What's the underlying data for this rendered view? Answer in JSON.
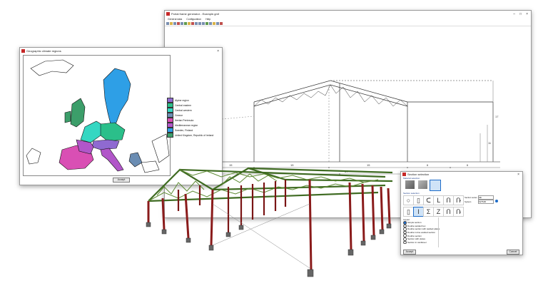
{
  "generator_window": {
    "title": "Portal frame generator - Example.gmf",
    "menu": [
      "General data",
      "Configuration",
      "Help"
    ],
    "dims": {
      "span_labels": [
        "15",
        "15",
        "15",
        "6",
        "6"
      ],
      "total_width": "57",
      "height_right": "17",
      "height_right_2": "11"
    }
  },
  "map_window": {
    "title": "Geographic climate regions",
    "legend": [
      {
        "label": "Alpine region",
        "color": "#8f6ad1"
      },
      {
        "label": "Central eastern",
        "color": "#2bbf8a"
      },
      {
        "label": "Central western",
        "color": "#35d7c2"
      },
      {
        "label": "Greece",
        "color": "#6b8db3"
      },
      {
        "label": "Iberian Peninsula",
        "color": "#d94fb4"
      },
      {
        "label": "Mediterranean region",
        "color": "#b156c9"
      },
      {
        "label": "Sweden, Finland",
        "color": "#2e9fe6"
      },
      {
        "label": "United Kingdom, Republic of Ireland",
        "color": "#3c9e6a"
      }
    ],
    "accept_label": "Accept"
  },
  "section_window": {
    "title": "Section selection",
    "material_label": "Material selection",
    "section_types_label": "Section selection",
    "grade_label": "Section series",
    "system_label": "System",
    "grade_value": "HE",
    "system_value": "S275JR",
    "layout_label": "Layout",
    "layout_options": [
      "Simple section",
      "Double welded box",
      "Double section with welded plates",
      "Double in-line welded section",
      "Double section",
      "Section with plates",
      "Section in cantilever"
    ],
    "layout_selected": 0,
    "accept_label": "Accept",
    "cancel_label": "Cancel"
  }
}
